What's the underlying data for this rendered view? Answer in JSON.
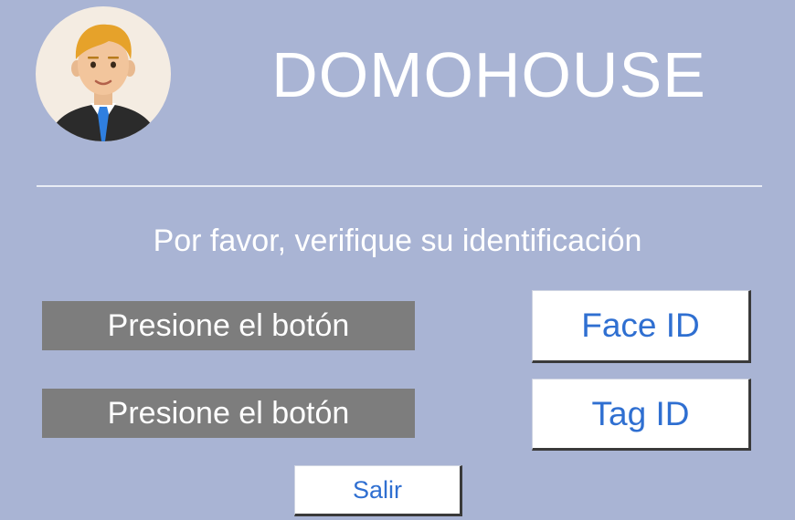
{
  "header": {
    "title": "DOMOHOUSE"
  },
  "avatar": {
    "icon": "user-avatar-icon"
  },
  "prompt": "Por favor, verifique su identificación",
  "rows": [
    {
      "status": "Presione el botón",
      "button": "Face ID"
    },
    {
      "status": "Presione el botón",
      "button": "Tag ID"
    }
  ],
  "exit_button": "Salir",
  "colors": {
    "background": "#a9b4d4",
    "status_bg": "#7d7d7d",
    "button_text": "#2f6fd1",
    "avatar_bg": "#f4ece2"
  }
}
